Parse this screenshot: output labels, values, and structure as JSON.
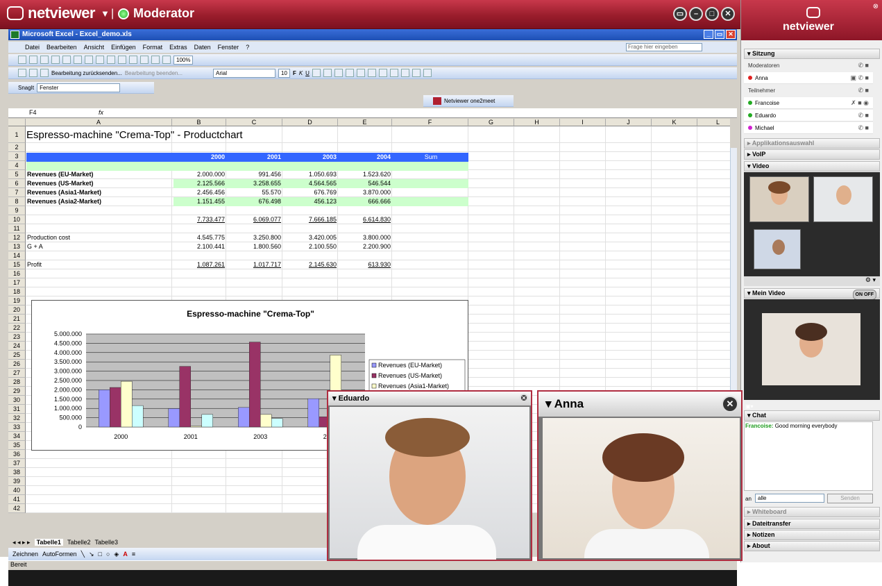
{
  "app": {
    "brand": "netviewer",
    "role": "Moderator"
  },
  "excel": {
    "title": "Microsoft Excel - Excel_demo.xls",
    "menu": [
      "Datei",
      "Bearbeiten",
      "Ansicht",
      "Einfügen",
      "Format",
      "Extras",
      "Daten",
      "Fenster",
      "?"
    ],
    "ask_placeholder": "Frage hier eingeben",
    "zoom": "100%",
    "review_btn": "Bearbeitung zurücksenden...",
    "review_end": "Bearbeitung beenden...",
    "font": "Arial",
    "font_size": "10",
    "snagit": "SnagIt",
    "window": "Fenster",
    "one2meet": "Netviewer one2meet",
    "cell_ref": "F4",
    "fx": "fx",
    "columns": [
      "A",
      "B",
      "C",
      "D",
      "E",
      "F",
      "G",
      "H",
      "I",
      "J",
      "K",
      "L"
    ],
    "title_cell": "Espresso-machine \"Crema-Top\" - Productchart",
    "header_years": [
      "2000",
      "2001",
      "2003",
      "2004",
      "Sum"
    ],
    "rows": [
      {
        "r": "5",
        "label": "Revenues (EU-Market)",
        "v": [
          "2.000.000",
          "991.456",
          "1.050.693",
          "1.523.620"
        ],
        "bold": true
      },
      {
        "r": "6",
        "label": "Revenues (US-Market)",
        "v": [
          "2.125.566",
          "3.258.655",
          "4.564.565",
          "546.544"
        ],
        "bold": true
      },
      {
        "r": "7",
        "label": "Revenues (Asia1-Market)",
        "v": [
          "2.456.456",
          "55.570",
          "676.769",
          "3.870.000"
        ],
        "bold": true
      },
      {
        "r": "8",
        "label": "Revenues (Asia2-Market)",
        "v": [
          "1.151.455",
          "676.498",
          "456.123",
          "666.666"
        ],
        "bold": true
      },
      {
        "r": "10",
        "label": "",
        "v": [
          "7.733.477",
          "6.069.077",
          "7.666.185",
          "6.614.830"
        ],
        "bold": false
      },
      {
        "r": "12",
        "label": "Production cost",
        "v": [
          "4.545.775",
          "3.250.800",
          "3.420.005",
          "3.800.000"
        ],
        "bold": false
      },
      {
        "r": "13",
        "label": "G + A",
        "v": [
          "2.100.441",
          "1.800.560",
          "2.100.550",
          "2.200.900"
        ],
        "bold": false
      },
      {
        "r": "15",
        "label": "Profit",
        "v": [
          "1.087.261",
          "1.017.717",
          "2.145.630",
          "613.930"
        ],
        "bold": false
      }
    ],
    "sheet_tabs": [
      "Tabelle1",
      "Tabelle2",
      "Tabelle3"
    ],
    "draw": "Zeichnen",
    "autoshapes": "AutoFormen",
    "status": "Bereit"
  },
  "chart_data": {
    "type": "bar",
    "title": "Espresso-machine \"Crema-Top\"",
    "categories": [
      "2000",
      "2001",
      "2003",
      "2004"
    ],
    "series": [
      {
        "name": "Revenues (EU-Market)",
        "values": [
          2000000,
          991456,
          1050693,
          1523620
        ],
        "color": "#9999ff"
      },
      {
        "name": "Revenues (US-Market)",
        "values": [
          2125566,
          3258655,
          4564565,
          546544
        ],
        "color": "#993366"
      },
      {
        "name": "Revenues (Asia1-Market)",
        "values": [
          2456456,
          55570,
          676769,
          3870000
        ],
        "color": "#ffffcc"
      },
      {
        "name": "Revenues (Asia2-Market)",
        "values": [
          1151455,
          676498,
          456123,
          666666
        ],
        "color": "#ccffff"
      }
    ],
    "yticks": [
      "5.000.000",
      "4.500.000",
      "4.000.000",
      "3.500.000",
      "3.000.000",
      "2.500.000",
      "2.000.000",
      "1.500.000",
      "1.000.000",
      "500.000",
      "0"
    ],
    "ylim": [
      0,
      5000000
    ],
    "legend": "right",
    "grid": true
  },
  "panel": {
    "brand": "netviewer",
    "session": "Sitzung",
    "moderators_label": "Moderatoren",
    "participants_label": "Teilnehmer",
    "moderators": [
      {
        "name": "Anna",
        "color": "#e02020"
      }
    ],
    "participants": [
      {
        "name": "Francoise",
        "color": "#2a2"
      },
      {
        "name": "Eduardo",
        "color": "#2a2"
      },
      {
        "name": "Michael",
        "color": "#d020d0"
      }
    ],
    "app_select": "Applikationsauswahl",
    "voip": "VoIP",
    "video": "Video",
    "my_video": "Mein Video",
    "toggle": "ON OFF",
    "chat": "Chat",
    "chat_sender": "Francoise:",
    "chat_msg": "Good morning everybody",
    "to_label": "an",
    "to_value": "alle",
    "send": "Senden",
    "whiteboard": "Whiteboard",
    "filetransfer": "Dateitransfer",
    "notes": "Notizen",
    "about": "About"
  },
  "popups": [
    {
      "name": "Eduardo"
    },
    {
      "name": "Anna"
    }
  ]
}
